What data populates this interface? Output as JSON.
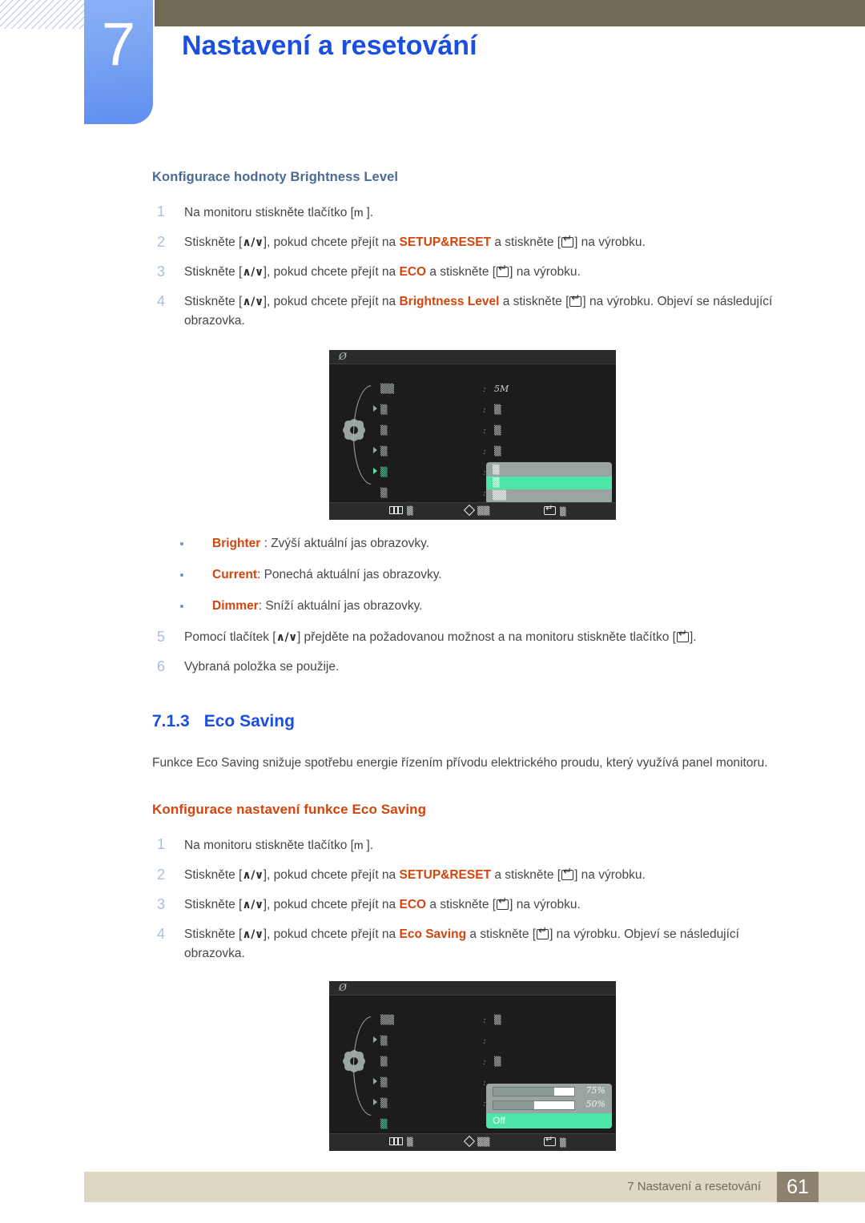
{
  "header": {
    "chapter_number": "7",
    "chapter_title": "Nastavení a resetování"
  },
  "section_brightness": {
    "heading": "Konfigurace hodnoty Brightness Level",
    "steps": [
      {
        "num": "1",
        "parts": [
          {
            "t": "text",
            "v": "Na monitoru stiskněte tlačítko ["
          },
          {
            "t": "kbd-m",
            "v": "m "
          },
          {
            "t": "text",
            "v": "]."
          }
        ]
      },
      {
        "num": "2",
        "parts": [
          {
            "t": "text",
            "v": "Stiskněte ["
          },
          {
            "t": "kbd",
            "v": "∧/∨"
          },
          {
            "t": "text",
            "v": "], pokud chcete přejít na "
          },
          {
            "t": "hl",
            "v": "SETUP&RESET"
          },
          {
            "t": "text",
            "v": " a stiskněte ["
          },
          {
            "t": "enter",
            "v": ""
          },
          {
            "t": "text",
            "v": "] na výrobku."
          }
        ]
      },
      {
        "num": "3",
        "parts": [
          {
            "t": "text",
            "v": "Stiskněte ["
          },
          {
            "t": "kbd",
            "v": "∧/∨"
          },
          {
            "t": "text",
            "v": "], pokud chcete přejít na "
          },
          {
            "t": "hl",
            "v": "ECO"
          },
          {
            "t": "text",
            "v": " a stiskněte ["
          },
          {
            "t": "enter",
            "v": ""
          },
          {
            "t": "text",
            "v": "] na výrobku."
          }
        ]
      },
      {
        "num": "4",
        "parts": [
          {
            "t": "text",
            "v": "Stiskněte ["
          },
          {
            "t": "kbd",
            "v": "∧/∨"
          },
          {
            "t": "text",
            "v": "], pokud chcete přejít na "
          },
          {
            "t": "hl",
            "v": "Brightness Level"
          },
          {
            "t": "text",
            "v": " a stiskněte ["
          },
          {
            "t": "enter",
            "v": ""
          },
          {
            "t": "text",
            "v": "] na výrobku. Objeví se následující obrazovka."
          }
        ]
      }
    ],
    "bullets": [
      {
        "parts": [
          {
            "t": "hl",
            "v": "Brighter"
          },
          {
            "t": "text",
            "v": " : Zvýší aktuální jas obrazovky."
          }
        ]
      },
      {
        "parts": [
          {
            "t": "hl",
            "v": "Current"
          },
          {
            "t": "text",
            "v": ": Ponechá aktuální jas obrazovky."
          }
        ]
      },
      {
        "parts": [
          {
            "t": "hl",
            "v": "Dimmer"
          },
          {
            "t": "text",
            "v": ": Sníží aktuální jas obrazovky."
          }
        ]
      }
    ],
    "steps_after": [
      {
        "num": "5",
        "parts": [
          {
            "t": "text",
            "v": "Pomocí tlačítek ["
          },
          {
            "t": "kbd",
            "v": "∧/∨"
          },
          {
            "t": "text",
            "v": "] přejděte na požadovanou možnost a na monitoru stiskněte tlačítko ["
          },
          {
            "t": "enter",
            "v": ""
          },
          {
            "t": "text",
            "v": "]."
          }
        ]
      },
      {
        "num": "6",
        "parts": [
          {
            "t": "text",
            "v": "Vybraná položka se použije."
          }
        ]
      }
    ]
  },
  "section_eco": {
    "number": "7.1.3",
    "title": "Eco Saving",
    "paragraph": "Funkce Eco Saving snižuje spotřebu energie řízením přívodu elektrického proudu, který využívá panel monitoru.",
    "heading": "Konfigurace nastavení funkce Eco Saving",
    "steps": [
      {
        "num": "1",
        "parts": [
          {
            "t": "text",
            "v": "Na monitoru stiskněte tlačítko ["
          },
          {
            "t": "kbd-m",
            "v": "m "
          },
          {
            "t": "text",
            "v": "]."
          }
        ]
      },
      {
        "num": "2",
        "parts": [
          {
            "t": "text",
            "v": "Stiskněte ["
          },
          {
            "t": "kbd",
            "v": "∧/∨"
          },
          {
            "t": "text",
            "v": "], pokud chcete přejít na "
          },
          {
            "t": "hl",
            "v": "SETUP&RESET"
          },
          {
            "t": "text",
            "v": " a stiskněte ["
          },
          {
            "t": "enter",
            "v": ""
          },
          {
            "t": "text",
            "v": "] na výrobku."
          }
        ]
      },
      {
        "num": "3",
        "parts": [
          {
            "t": "text",
            "v": "Stiskněte ["
          },
          {
            "t": "kbd",
            "v": "∧/∨"
          },
          {
            "t": "text",
            "v": "], pokud chcete přejít na "
          },
          {
            "t": "hl",
            "v": "ECO"
          },
          {
            "t": "text",
            "v": " a stiskněte ["
          },
          {
            "t": "enter",
            "v": ""
          },
          {
            "t": "text",
            "v": "] na výrobku."
          }
        ]
      },
      {
        "num": "4",
        "parts": [
          {
            "t": "text",
            "v": "Stiskněte ["
          },
          {
            "t": "kbd",
            "v": "∧/∨"
          },
          {
            "t": "text",
            "v": "], pokud chcete přejít na "
          },
          {
            "t": "hl",
            "v": "Eco Saving"
          },
          {
            "t": "text",
            "v": " a stiskněte ["
          },
          {
            "t": "enter",
            "v": ""
          },
          {
            "t": "text",
            "v": "] na výrobku. Objeví se následující obrazovka."
          }
        ]
      }
    ]
  },
  "osd_brightness": {
    "titlebar_glyph": "Ø",
    "menu_rows": [
      {
        "caret": false,
        "label": "▒▒",
        "selected": false
      },
      {
        "caret": true,
        "label": "▒",
        "selected": false
      },
      {
        "caret": false,
        "label": "▒",
        "selected": false
      },
      {
        "caret": true,
        "label": "▒",
        "selected": false
      },
      {
        "caret": true,
        "label": "▒",
        "selected": true
      },
      {
        "caret": false,
        "label": "▒",
        "selected": false
      },
      {
        "caret": false,
        "label": "▒",
        "selected": false
      }
    ],
    "values": [
      "5M",
      "▒",
      "▒",
      "▒",
      "",
      "▒"
    ],
    "popup_items": [
      {
        "label": "▒",
        "active": false
      },
      {
        "label": "▒",
        "active": true
      },
      {
        "label": "▒▒",
        "active": false
      }
    ],
    "bottom_items": [
      {
        "icon": "bars-icon",
        "label": "▒"
      },
      {
        "icon": "diamond-icon",
        "label": "▒▒"
      },
      {
        "icon": "return-icon",
        "label": "▒"
      }
    ]
  },
  "osd_ecosaving": {
    "titlebar_glyph": "Ø",
    "menu_rows": [
      {
        "caret": false,
        "label": "▒▒",
        "selected": false
      },
      {
        "caret": true,
        "label": "▒",
        "selected": false
      },
      {
        "caret": false,
        "label": "▒",
        "selected": false
      },
      {
        "caret": true,
        "label": "▒",
        "selected": false
      },
      {
        "caret": true,
        "label": "▒",
        "selected": false
      },
      {
        "caret": false,
        "label": "▒",
        "selected": true
      },
      {
        "caret": false,
        "label": "▒",
        "selected": false
      }
    ],
    "values": [
      "▒",
      "",
      "▒",
      "",
      ""
    ],
    "sliders": [
      {
        "value": "75%",
        "percent": 75
      },
      {
        "value": "50%",
        "percent": 50
      }
    ],
    "off_label": "Off",
    "bottom_items": [
      {
        "icon": "bars-icon",
        "label": "▒"
      },
      {
        "icon": "diamond-icon",
        "label": "▒▒"
      },
      {
        "icon": "return-icon",
        "label": "▒"
      }
    ]
  },
  "footer": {
    "text": "7 Nastavení a resetování",
    "page": "61"
  },
  "colors": {
    "accent_blue": "#1a4fe0",
    "highlight_orange": "#d3450d",
    "olive": "#706b54",
    "badge_blue": "#7ba4f2",
    "footer_bg": "#ddd7c4",
    "page_box": "#8d8270",
    "osd_green": "#4ee6a8"
  }
}
